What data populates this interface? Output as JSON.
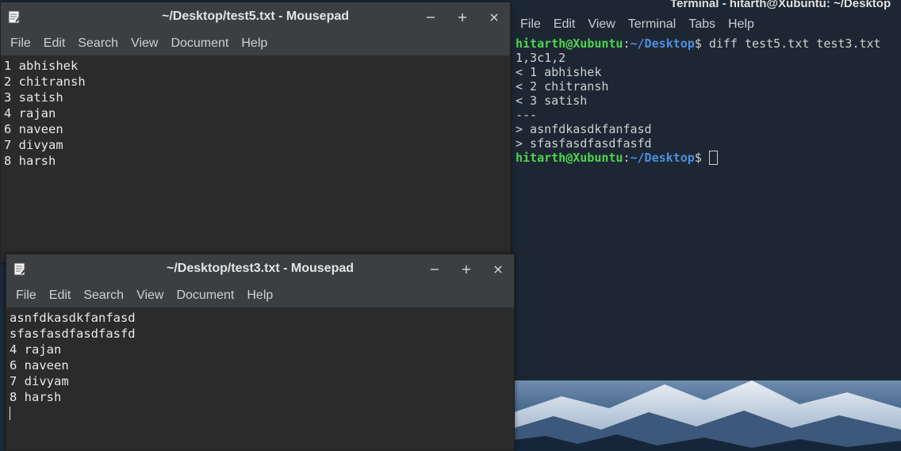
{
  "terminal": {
    "title": "Terminal - hitarth@Xubuntu: ~/Desktop",
    "menu": [
      "File",
      "Edit",
      "View",
      "Terminal",
      "Tabs",
      "Help"
    ],
    "prompt_user": "hitarth@Xubuntu",
    "prompt_sep": ":",
    "prompt_path": "~/Desktop",
    "prompt_end": "$ ",
    "command": "diff test5.txt test3.txt",
    "output": [
      "1,3c1,2",
      "< 1 abhishek",
      "< 2 chitransh",
      "< 3 satish",
      "---",
      "> asnfdkasdkfanfasd",
      "> sfasfasdfasdfasfd"
    ]
  },
  "window1": {
    "title": "~/Desktop/test5.txt - Mousepad",
    "menu": [
      "File",
      "Edit",
      "Search",
      "View",
      "Document",
      "Help"
    ],
    "controls": {
      "minimize": "−",
      "maximize": "+",
      "close": "×"
    },
    "lines": [
      "1 abhishek",
      "2 chitransh",
      "3 satish",
      "4 rajan",
      "6 naveen",
      "7 divyam",
      "8 harsh"
    ]
  },
  "window2": {
    "title": "~/Desktop/test3.txt - Mousepad",
    "menu": [
      "File",
      "Edit",
      "Search",
      "View",
      "Document",
      "Help"
    ],
    "controls": {
      "minimize": "−",
      "maximize": "+",
      "close": "×"
    },
    "lines": [
      "asnfdkasdkfanfasd",
      "sfasfasdfasdfasfd",
      "4 rajan",
      "6 naveen",
      "7 divyam",
      "8 harsh"
    ]
  },
  "icons": {
    "app": "mousepad-icon",
    "colors": {
      "prompt_user": "#4ed44e",
      "prompt_path": "#4d8fe0",
      "editor_bg": "#2b2b2b",
      "terminal_bg": "#1d2733"
    }
  }
}
